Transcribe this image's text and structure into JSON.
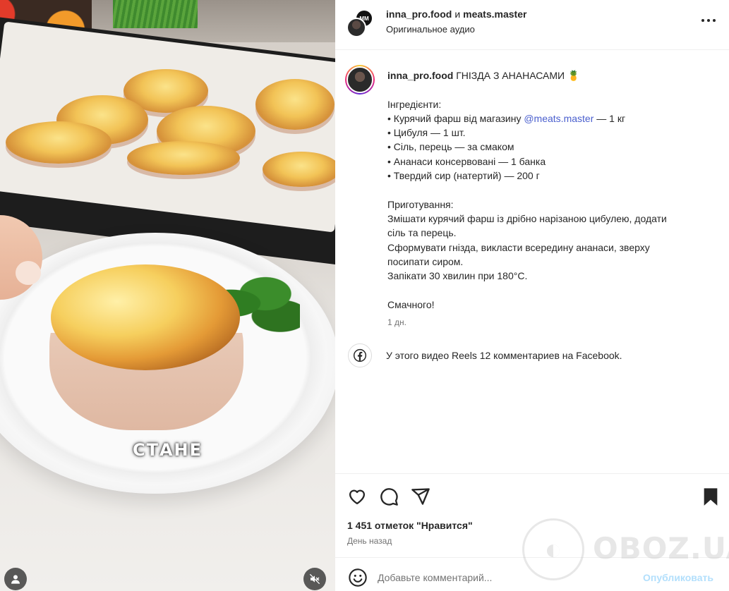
{
  "media": {
    "caption_overlay": "СТАНЕ",
    "profile_icon": "person-icon",
    "mute_icon": "speaker-muted-icon"
  },
  "header": {
    "user1": "inna_pro.food",
    "connector": "и",
    "user2": "meats.master",
    "audio": "Оригинальное аудио",
    "more_icon": "more-horizontal-icon"
  },
  "post": {
    "author": "inna_pro.food",
    "title": "ГНІЗДА З АНАНАСАМИ 🍍",
    "ingredients_heading": "Інгредієнти:",
    "ing1_prefix": "• Курячий фарш від магазину ",
    "ing1_mention": "@meats.master",
    "ing1_suffix": " — 1 кг",
    "ing2": "• Цибуля — 1 шт.",
    "ing3": "• Сіль, перець — за смаком",
    "ing4": "• Ананаси консервовані — 1 банка",
    "ing5": "• Твердий сир (натертий) — 200 г",
    "prep_heading": "Приготування:",
    "prep1": "Змішати курячий фарш із дрібно нарізаною цибулею, додати",
    "prep2": "сіль та перець.",
    "prep3": "Сформувати гнізда, викласти всередину ананаси, зверху",
    "prep4": "посипати сиром.",
    "prep5": "Запікати 30 хвилин при 180°C.",
    "closing": "Смачного!",
    "time": "1 дн."
  },
  "facebook": {
    "text": "У этого видео Reels 12 комментариев на Facebook.",
    "icon": "facebook-icon"
  },
  "actions": {
    "like_icon": "heart-icon",
    "comment_icon": "comment-icon",
    "share_icon": "share-icon",
    "save_icon": "bookmark-icon"
  },
  "likes": "1 451 отметок \"Нравится\"",
  "date": "День назад",
  "comment": {
    "placeholder": "Добавьте комментарий...",
    "publish": "Опубликовать",
    "emoji_icon": "emoji-icon"
  },
  "watermark": {
    "text": "OBOZ.UA"
  },
  "colors": {
    "accent": "#0095f6",
    "publish_disabled": "#b2dffc",
    "mention": "#4a5fce",
    "secondary_text": "#737373"
  }
}
